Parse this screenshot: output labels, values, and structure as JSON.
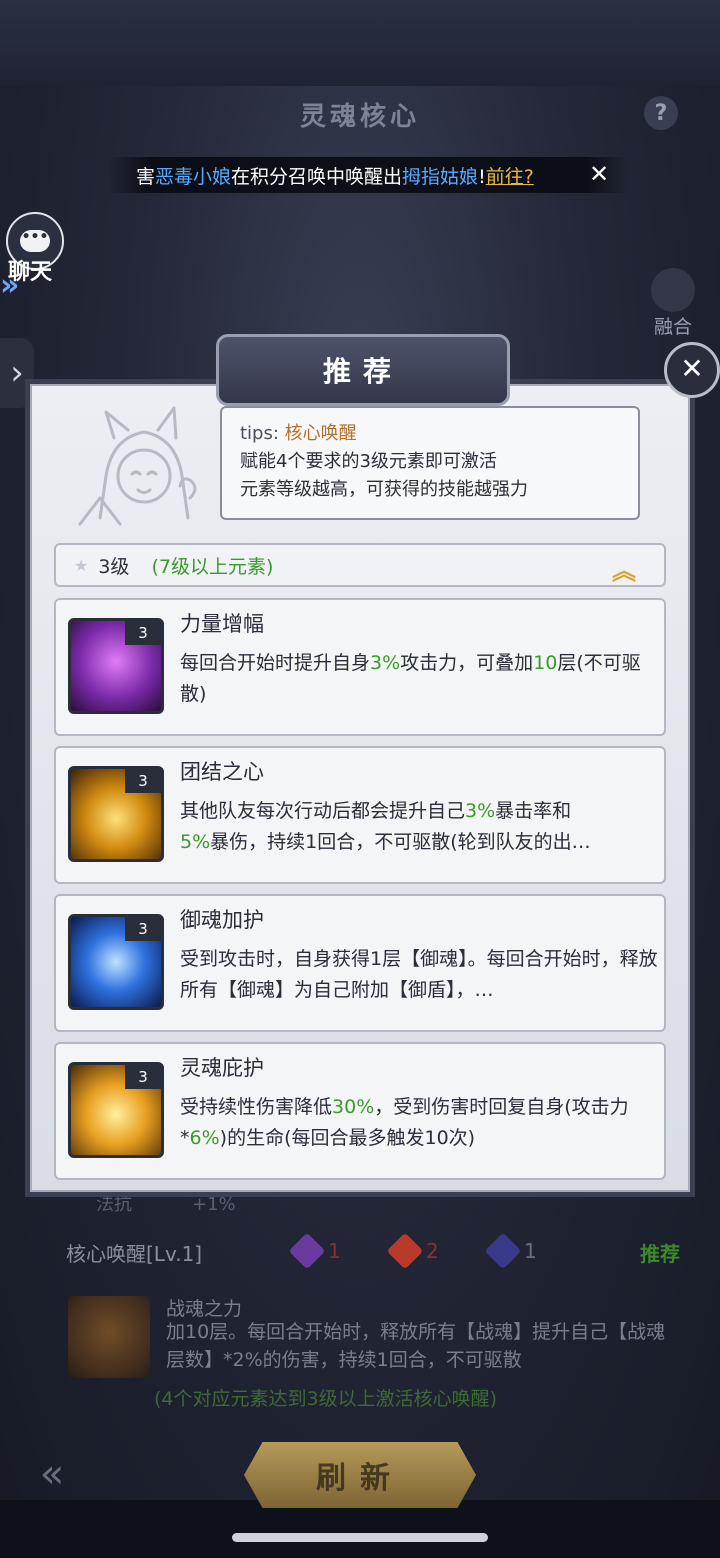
{
  "page": {
    "title": "灵魂核心",
    "help_glyph": "?"
  },
  "marquee": {
    "prefix": "害",
    "name1": "恶毒小娘",
    "middle": "在积分召唤中唤醒出",
    "name2": "拇指姑娘",
    "bang": "!",
    "link": "前往?",
    "close_glyph": "✕"
  },
  "sidebar": {
    "chat_glyph": "•••",
    "chat_label": "聊天",
    "expand_glyph": "»",
    "panel_glyph": "›",
    "fuse_label": "融合"
  },
  "popup": {
    "title": "推荐",
    "close_glyph": "✕",
    "tips": {
      "prefix": "tips:",
      "title": "核心唤醒",
      "line1": "赋能4个要求的3级元素即可激活",
      "line2": "元素等级越高，可获得的技能越强力"
    },
    "level": {
      "label": "3级",
      "requirement": "(7级以上元素)",
      "collapse_glyph": "︽"
    },
    "skills": [
      {
        "level": "3",
        "name": "力量增幅",
        "d1": "每回合开始时提升自身",
        "g1": "3%",
        "d2": "攻击力，可叠加",
        "g2": "10",
        "d3": "层(不可驱散)",
        "icon_color": "#b04ad8"
      },
      {
        "level": "3",
        "name": "团结之心",
        "d1": "其他队友每次行动后都会提升自己",
        "g1": "3%",
        "d2": "暴击率和",
        "g2": "5%",
        "d3": "暴伤，持续1回合，不可驱散(轮到队友的出…",
        "icon_color": "#e0a020"
      },
      {
        "level": "3",
        "name": "御魂加护",
        "d1": "受到攻击时，自身获得1层【御魂】。每回合开始时，释放所有【御魂】为自己附加【御盾】，…",
        "g1": "",
        "d2": "",
        "g2": "",
        "d3": "",
        "icon_color": "#2f72e0"
      },
      {
        "level": "3",
        "name": "灵魂庇护",
        "d1": "受持续性伤害降低",
        "g1": "30%",
        "d2": "，受到伤害时回复自身(攻击力*",
        "g2": "6%",
        "d3": ")的生命(每回合最多触发10次)",
        "icon_color": "#e8b02a"
      }
    ]
  },
  "background": {
    "stat_name": "法抗",
    "stat_value": "+1%",
    "core_label": "核心唤醒[Lv.1]",
    "elements": [
      {
        "count": "1",
        "color": "#6a3aa0"
      },
      {
        "count": "2",
        "color": "#b83a2a"
      },
      {
        "count": "1",
        "color": "#3a3a8a"
      }
    ],
    "recommend": "推荐",
    "skill_name": "战魂之力",
    "skill_desc": "加10层。每回合开始时，释放所有【战魂】提升自己【战魂层数】*2%的伤害，持续1回合，不可驱散",
    "note": "(4个对应元素达到3级以上激活核心唤醒)",
    "refresh": "刷新",
    "back_glyph": "«"
  }
}
